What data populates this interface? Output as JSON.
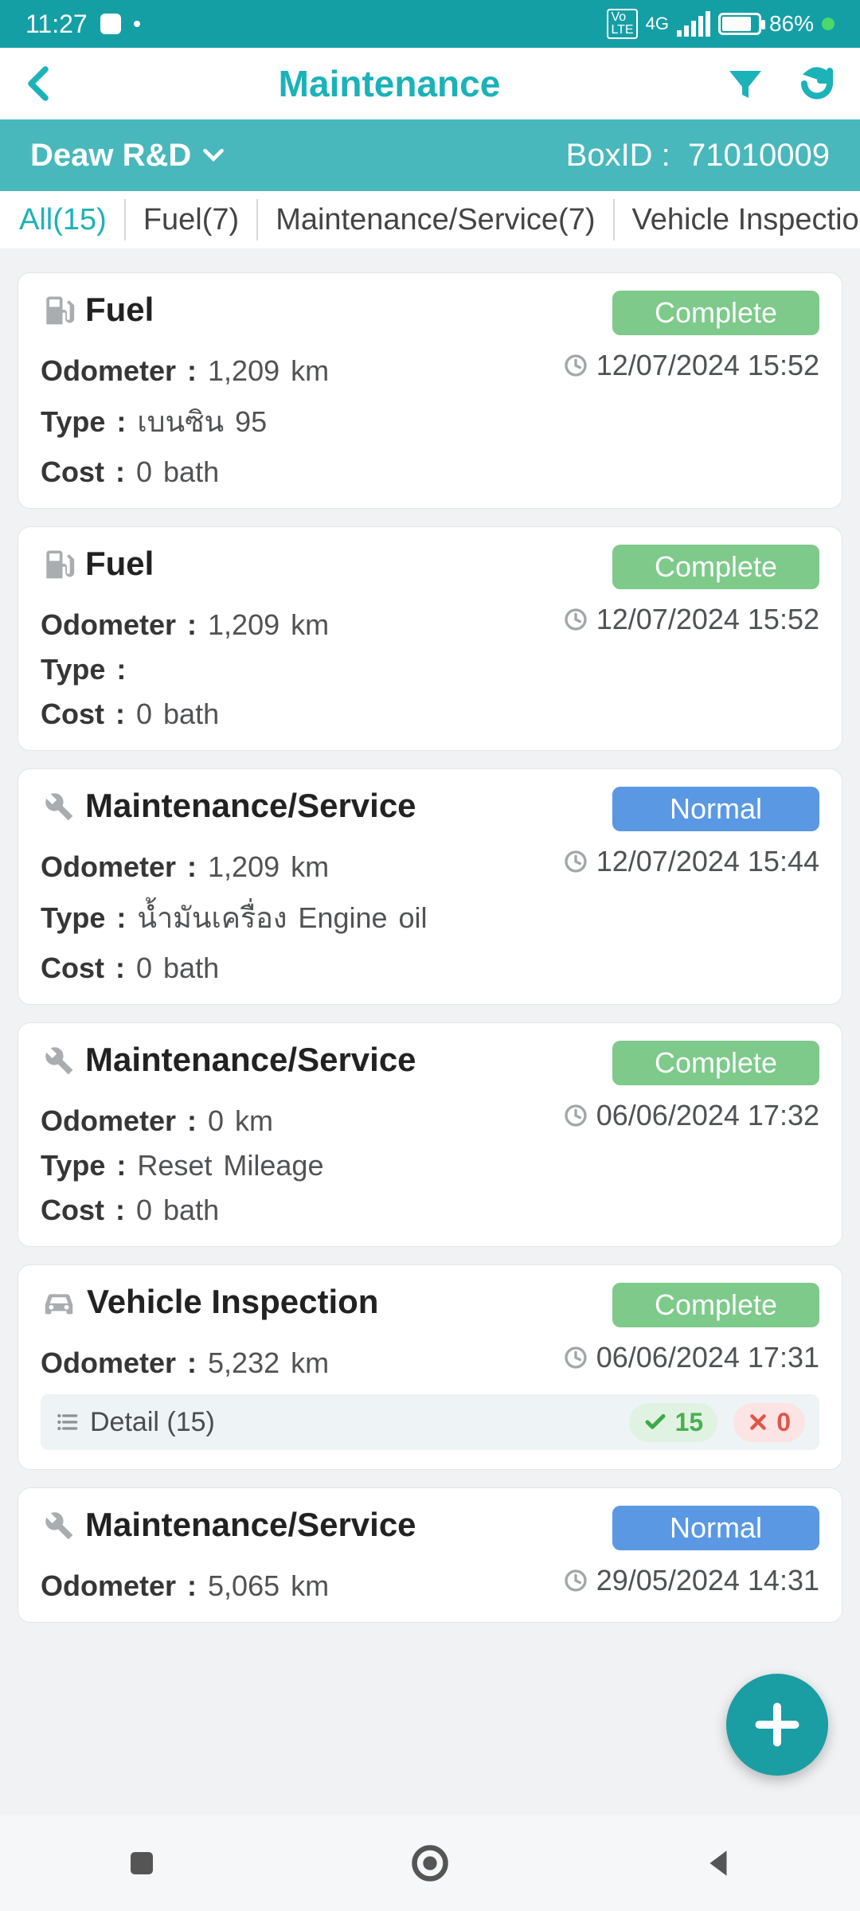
{
  "status": {
    "time": "11:27",
    "battery": "86%",
    "net": "4G"
  },
  "header": {
    "title": "Maintenance"
  },
  "vehicle": {
    "name": "Deaw R&D",
    "box_label": "BoxID :",
    "box_id": "71010009"
  },
  "tabs": [
    {
      "label": "All(15)",
      "active": true
    },
    {
      "label": "Fuel(7)",
      "active": false
    },
    {
      "label": "Maintenance/Service(7)",
      "active": false
    },
    {
      "label": "Vehicle Inspection(",
      "active": false
    }
  ],
  "labels": {
    "odometer": "Odometer :",
    "type": "Type :",
    "cost": "Cost :",
    "detail": "Detail"
  },
  "records": [
    {
      "icon": "fuel",
      "title": "Fuel",
      "status": "Complete",
      "status_kind": "complete",
      "odometer": "1,209 km",
      "type": "เบนซิน 95",
      "cost": "0 bath",
      "datetime": "12/07/2024 15:52"
    },
    {
      "icon": "fuel",
      "title": "Fuel",
      "status": "Complete",
      "status_kind": "complete",
      "odometer": "1,209 km",
      "type": "",
      "cost": "0 bath",
      "datetime": "12/07/2024 15:52"
    },
    {
      "icon": "wrench",
      "title": "Maintenance/Service",
      "status": "Normal",
      "status_kind": "normal",
      "odometer": "1,209 km",
      "type": "น้ำมันเครื่อง Engine oil",
      "cost": "0 bath",
      "datetime": "12/07/2024 15:44"
    },
    {
      "icon": "wrench",
      "title": "Maintenance/Service",
      "status": "Complete",
      "status_kind": "complete",
      "odometer": "0 km",
      "type": "Reset Mileage",
      "cost": "0 bath",
      "datetime": "06/06/2024 17:32"
    },
    {
      "icon": "car",
      "title": "Vehicle Inspection",
      "status": "Complete",
      "status_kind": "complete",
      "odometer": "5,232 km",
      "type": null,
      "cost": null,
      "datetime": "06/06/2024 17:31",
      "detail": {
        "count": "(15)",
        "pass": "15",
        "fail": "0"
      }
    },
    {
      "icon": "wrench",
      "title": "Maintenance/Service",
      "status": "Normal",
      "status_kind": "normal",
      "odometer": "5,065 km",
      "type": null,
      "cost": null,
      "datetime": "29/05/2024 14:31"
    }
  ]
}
